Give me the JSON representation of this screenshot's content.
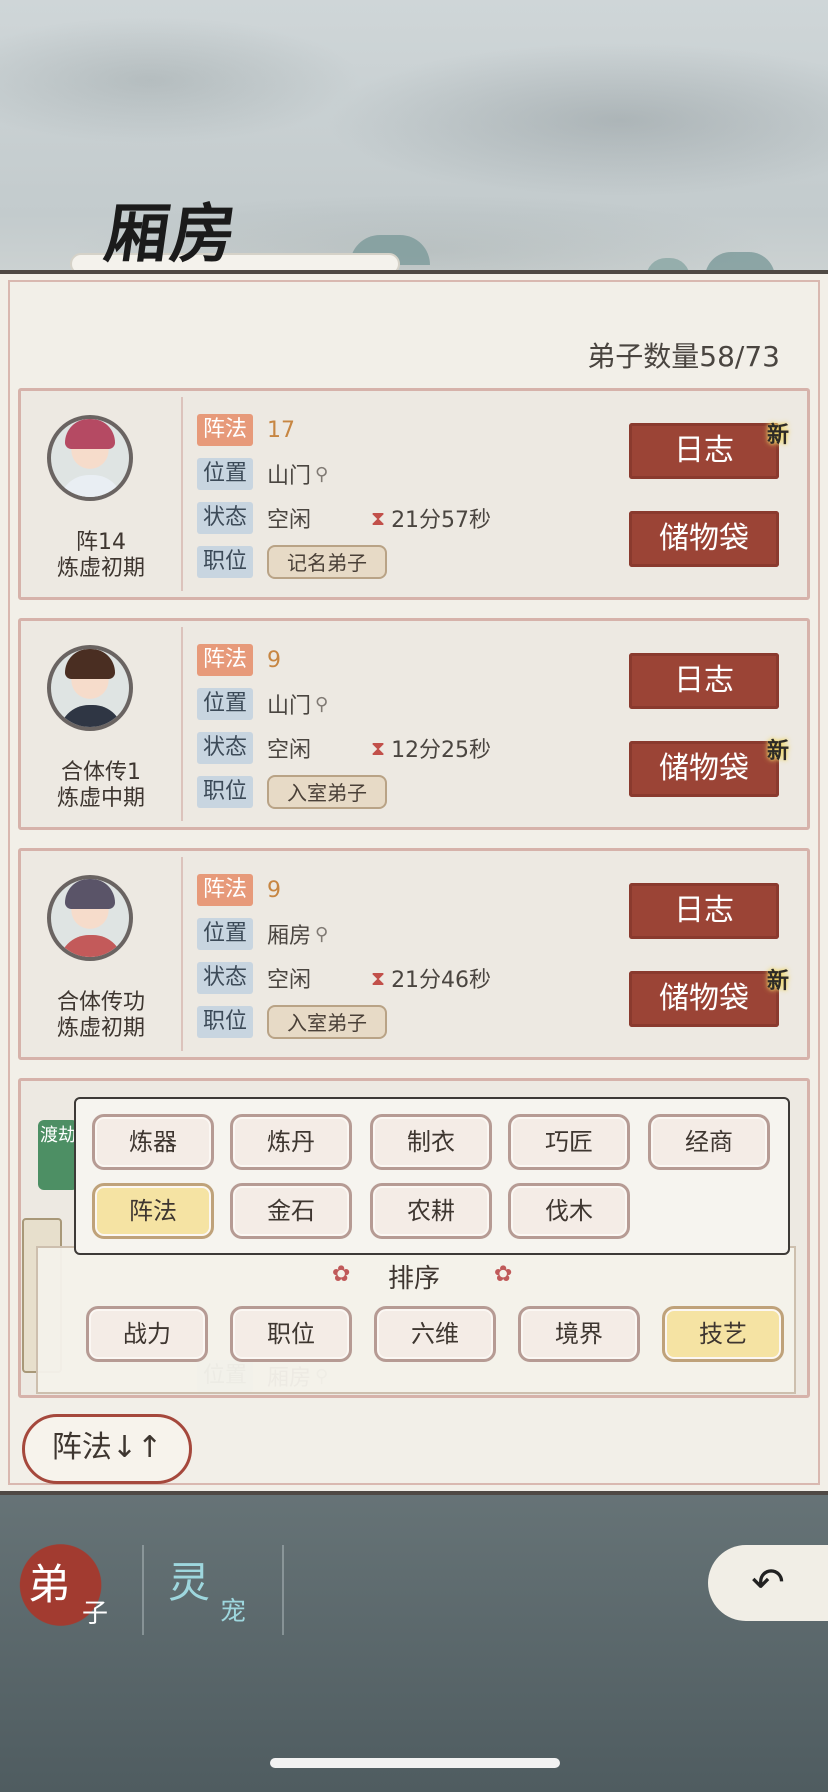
{
  "header": {
    "title": "厢房"
  },
  "disciple_count": "弟子数量58/73",
  "labels": {
    "skill": "阵法",
    "location": "位置",
    "status": "状态",
    "position": "职位",
    "log_button": "日志",
    "bag_button": "储物袋",
    "new_badge": "新"
  },
  "disciples": [
    {
      "name": "阵14",
      "realm": "炼虚初期",
      "skill_value": "17",
      "location": "山门",
      "status": "空闲",
      "timer": "21分57秒",
      "rank": "记名弟子"
    },
    {
      "name": "合体传1",
      "realm": "炼虚中期",
      "skill_value": "9",
      "location": "山门",
      "status": "空闲",
      "timer": "12分25秒",
      "rank": "入室弟子"
    },
    {
      "name": "合体传功",
      "realm": "炼虚初期",
      "skill_value": "9",
      "location": "厢房",
      "status": "空闲",
      "timer": "21分46秒",
      "rank": "入室弟子"
    }
  ],
  "peek_row": {
    "badge": "渡劫",
    "location_label": "位置",
    "location": "厢房"
  },
  "filter": {
    "options": [
      "炼器",
      "炼丹",
      "制衣",
      "巧匠",
      "经商",
      "阵法",
      "金石",
      "农耕",
      "伐木"
    ],
    "selected": "阵法"
  },
  "sort": {
    "title": "排序",
    "options": [
      "战力",
      "职位",
      "六维",
      "境界",
      "技艺"
    ],
    "selected": "技艺"
  },
  "current_sort_button": "阵法↓↑",
  "nav": {
    "tab1_big": "弟",
    "tab1_small": "子",
    "tab2_big": "灵",
    "tab2_small": "宠",
    "back_icon": "↶"
  },
  "colors": {
    "accent_red": "#9b4436",
    "selected_chip": "#f5e3a3",
    "skill_tag": "#e79a7a"
  }
}
